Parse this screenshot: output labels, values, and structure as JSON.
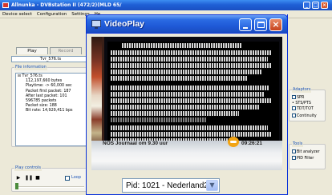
{
  "app": {
    "title": "Allnunka - DVBstation II (472/2)(MLD 65/ DVB)",
    "menu": [
      "Device select",
      "Configuration",
      "Settings",
      "He"
    ],
    "tabs": [
      "Play",
      "Record"
    ],
    "ts_file": "Tvr_576.ts",
    "file_info": {
      "title": "File information",
      "root": "Tvr_576.ts",
      "items": [
        "112,197,660 bytes",
        "Playtime: -> 60,000 sec",
        "Packet first packet: 187",
        "After last packet: 101",
        "596785 packets",
        "Packet size: 188",
        "Bit rate: 14,929,411 bps"
      ]
    },
    "play_controls": {
      "title": "Play controls",
      "buttons": [
        "▶",
        "❚❚",
        "■"
      ],
      "loop_label": "Loop"
    },
    "adaptors": {
      "title": "Adaptors",
      "items": [
        "SPR",
        "• STS/PTS",
        "TDT/TOT",
        "Continuity"
      ]
    },
    "tools": {
      "title": "Tools",
      "items": [
        "Bit analyzer",
        "PID Filter"
      ]
    }
  },
  "videoplay": {
    "title": "VideoPlay",
    "banner_left": "NOS Journaal om 9.30 uur",
    "banner_right": "09:26:21",
    "channel": {
      "selected": "Pid: 1021 - Nederland2"
    }
  }
}
